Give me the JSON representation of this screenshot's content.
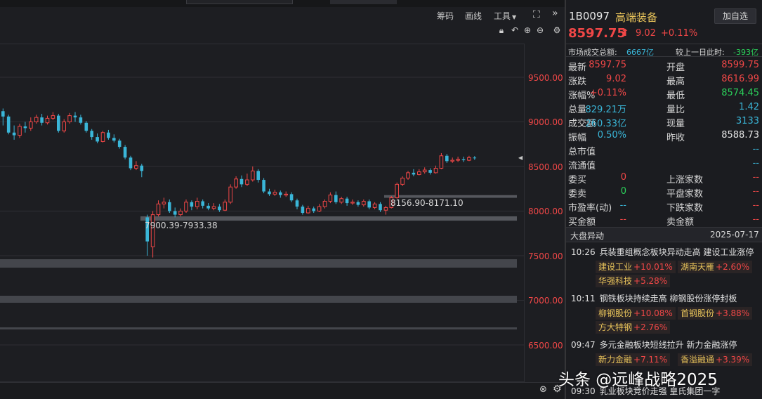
{
  "toolbar": {
    "chips": "筹码",
    "draw": "画线",
    "tools": "工具"
  },
  "chart": {
    "y_ticks": [
      "9500.00",
      "9000.00",
      "8500.00",
      "8000.00",
      "7500.00",
      "7000.00",
      "6500.00"
    ],
    "range_low_label": "7900.39-7933.38",
    "range_mid_label": "8156.90-8171.10"
  },
  "chart_data": {
    "type": "candlestick",
    "ylim": [
      6250,
      9800
    ],
    "y_ticks": [
      9500,
      9000,
      8500,
      8000,
      7500,
      7000,
      6500
    ],
    "up_color": "#f04747",
    "down_color": "#3ab6d8",
    "candles": [
      [
        9120,
        9060,
        9150,
        8960
      ],
      [
        9060,
        8880,
        9080,
        8860
      ],
      [
        8880,
        8850,
        8960,
        8800
      ],
      [
        8850,
        8950,
        8980,
        8820
      ],
      [
        8950,
        8930,
        9000,
        8880
      ],
      [
        8930,
        9000,
        9050,
        8900
      ],
      [
        9000,
        9050,
        9080,
        8980
      ],
      [
        9050,
        8990,
        9090,
        8960
      ],
      [
        8990,
        9040,
        9070,
        8970
      ],
      [
        9040,
        9070,
        9110,
        9020
      ],
      [
        9070,
        8900,
        9090,
        8880
      ],
      [
        8900,
        9000,
        9030,
        8880
      ],
      [
        9000,
        9070,
        9100,
        8980
      ],
      [
        9070,
        9050,
        9110,
        9000
      ],
      [
        9050,
        8990,
        9080,
        8970
      ],
      [
        8990,
        8900,
        9010,
        8880
      ],
      [
        8900,
        8830,
        8920,
        8800
      ],
      [
        8830,
        8780,
        8870,
        8760
      ],
      [
        8780,
        8880,
        8900,
        8770
      ],
      [
        8880,
        8820,
        8910,
        8800
      ],
      [
        8820,
        8790,
        8860,
        8770
      ],
      [
        8790,
        8720,
        8810,
        8700
      ],
      [
        8720,
        8600,
        8740,
        8580
      ],
      [
        8600,
        8480,
        8620,
        8460
      ],
      [
        8480,
        8510,
        8560,
        8460
      ],
      [
        8510,
        8450,
        8530,
        8380
      ],
      [
        7930,
        7660,
        7960,
        7500
      ],
      [
        7600,
        7960,
        8000,
        7480
      ],
      [
        7960,
        8080,
        8120,
        7940
      ],
      [
        8080,
        8100,
        8150,
        8030
      ],
      [
        8100,
        8000,
        8130,
        7980
      ],
      [
        8000,
        7960,
        8040,
        7930
      ],
      [
        7960,
        8000,
        8030,
        7940
      ],
      [
        8000,
        8100,
        8130,
        7980
      ],
      [
        8100,
        8050,
        8120,
        8010
      ],
      [
        8050,
        8110,
        8150,
        8020
      ],
      [
        8110,
        8060,
        8130,
        8030
      ],
      [
        8060,
        8030,
        8090,
        8010
      ],
      [
        8030,
        8050,
        8090,
        8010
      ],
      [
        8050,
        8010,
        8080,
        7990
      ],
      [
        8010,
        8100,
        8130,
        8000
      ],
      [
        8100,
        8270,
        8300,
        8080
      ],
      [
        8270,
        8360,
        8390,
        8250
      ],
      [
        8360,
        8300,
        8400,
        8270
      ],
      [
        8300,
        8350,
        8420,
        8280
      ],
      [
        8350,
        8450,
        8500,
        8330
      ],
      [
        8450,
        8350,
        8470,
        8320
      ],
      [
        8350,
        8220,
        8370,
        8200
      ],
      [
        8220,
        8190,
        8250,
        8170
      ],
      [
        8190,
        8210,
        8240,
        8170
      ],
      [
        8210,
        8180,
        8230,
        8150
      ],
      [
        8180,
        8190,
        8220,
        8160
      ],
      [
        8190,
        8120,
        8210,
        8100
      ],
      [
        8120,
        8050,
        8140,
        8020
      ],
      [
        8050,
        7980,
        8070,
        7960
      ],
      [
        7980,
        8030,
        8060,
        7970
      ],
      [
        8030,
        8000,
        8050,
        7980
      ],
      [
        8000,
        8050,
        8080,
        7990
      ],
      [
        8050,
        8110,
        8130,
        8030
      ],
      [
        8110,
        8180,
        8210,
        8090
      ],
      [
        8180,
        8100,
        8220,
        8080
      ],
      [
        8100,
        8140,
        8160,
        8080
      ],
      [
        8140,
        8090,
        8160,
        8060
      ],
      [
        8090,
        8100,
        8130,
        8070
      ],
      [
        8100,
        8070,
        8120,
        8050
      ],
      [
        8070,
        8110,
        8130,
        8050
      ],
      [
        8110,
        8040,
        8130,
        8020
      ],
      [
        8040,
        8080,
        8100,
        8020
      ],
      [
        8080,
        8010,
        8100,
        7990
      ],
      [
        8010,
        8040,
        8060,
        7960
      ],
      [
        8040,
        8150,
        8170,
        8030
      ],
      [
        8150,
        8300,
        8320,
        8140
      ],
      [
        8300,
        8370,
        8390,
        8280
      ],
      [
        8370,
        8430,
        8450,
        8350
      ],
      [
        8430,
        8410,
        8470,
        8390
      ],
      [
        8410,
        8440,
        8470,
        8400
      ],
      [
        8440,
        8460,
        8490,
        8420
      ],
      [
        8460,
        8430,
        8480,
        8410
      ],
      [
        8430,
        8480,
        8510,
        8420
      ],
      [
        8480,
        8620,
        8650,
        8470
      ],
      [
        8620,
        8560,
        8640,
        8540
      ],
      [
        8560,
        8570,
        8600,
        8540
      ],
      [
        8570,
        8580,
        8610,
        8550
      ],
      [
        8580,
        8570,
        8610,
        8550
      ],
      [
        8570,
        8600,
        8620,
        8560
      ],
      [
        8600,
        8598,
        8617,
        8574
      ]
    ],
    "zones": [
      [
        7900.39,
        7933.38
      ],
      [
        8156.9,
        8171.1
      ]
    ]
  },
  "stock": {
    "code": "1B0097",
    "name": "高端装备",
    "add_label": "加自选",
    "price": "8597.75",
    "change": "9.02",
    "change_pct": "+0.11%"
  },
  "turnover": {
    "label": "市场成交总额:",
    "value": "6667亿",
    "cmp_label": "较上一日此时:",
    "cmp_value": "-393亿"
  },
  "quote": {
    "rows": [
      {
        "l1": "最新",
        "v1": "8597.75",
        "c1": "red",
        "l2": "开盘",
        "v2": "8599.75",
        "c2": "red"
      },
      {
        "l1": "涨跌",
        "v1": "9.02",
        "c1": "red",
        "l2": "最高",
        "v2": "8616.99",
        "c2": "red"
      },
      {
        "l1": "涨幅%",
        "v1": "+0.11%",
        "c1": "red",
        "l2": "最低",
        "v2": "8574.45",
        "c2": "green"
      },
      {
        "l1": "总量",
        "v1": "829.21万",
        "c1": "cyan",
        "l2": "量比",
        "v2": "1.42",
        "c2": "cyan"
      },
      {
        "l1": "成交额",
        "v1": "260.33亿",
        "c1": "cyan",
        "l2": "现量",
        "v2": "3133",
        "c2": "cyan"
      },
      {
        "l1": "振幅",
        "v1": "0.50%",
        "c1": "cyan",
        "l2": "昨收",
        "v2": "8588.73",
        "c2": "white"
      },
      {
        "l1": "总市值",
        "v1": "",
        "c1": "cyan",
        "l2": "",
        "v2": "--",
        "c2": "cyan"
      },
      {
        "l1": "流通值",
        "v1": "",
        "c1": "cyan",
        "l2": "",
        "v2": "--",
        "c2": "cyan"
      },
      {
        "l1": "委买",
        "v1": "0",
        "c1": "red",
        "l2": "上涨家数",
        "v2": "--",
        "c2": "red"
      },
      {
        "l1": "委卖",
        "v1": "0",
        "c1": "green",
        "l2": "平盘家数",
        "v2": "--",
        "c2": "red"
      },
      {
        "l1": "市盈率(动)",
        "v1": "--",
        "c1": "cyan",
        "l2": "下跌家数",
        "v2": "--",
        "c2": "red"
      },
      {
        "l1": "买金额",
        "v1": "--",
        "c1": "red",
        "l2": "卖金额",
        "v2": "--",
        "c2": "red"
      }
    ]
  },
  "alerts": {
    "title": "大盘异动",
    "date": "2025-07-17",
    "items": [
      {
        "time": "10:26",
        "text": "兵装重组概念板块异动走高 建设工业涨停",
        "tags": [
          {
            "n": "建设工业",
            "p": "+10.01%"
          },
          {
            "n": "湖南天雁",
            "p": "+2.60%"
          },
          {
            "n": "华强科技",
            "p": "+5.28%"
          }
        ]
      },
      {
        "time": "10:11",
        "text": "钢铁板块持续走高 柳钢股份涨停封板",
        "tags": [
          {
            "n": "柳钢股份",
            "p": "+10.08%"
          },
          {
            "n": "首钢股份",
            "p": "+3.88%"
          },
          {
            "n": "方大特钢",
            "p": "+2.76%"
          }
        ]
      },
      {
        "time": "09:47",
        "text": "多元金融板块短线拉升 新力金融涨停",
        "tags": [
          {
            "n": "新力金融",
            "p": "+7.11%"
          },
          {
            "n": "香溢融通",
            "p": "+3.39%"
          }
        ]
      },
      {
        "time": "09:30",
        "text": "乳业板块竞价走强 皇氏集团一字",
        "tags": []
      }
    ]
  },
  "watermark": "头条 @远峰战略2025"
}
